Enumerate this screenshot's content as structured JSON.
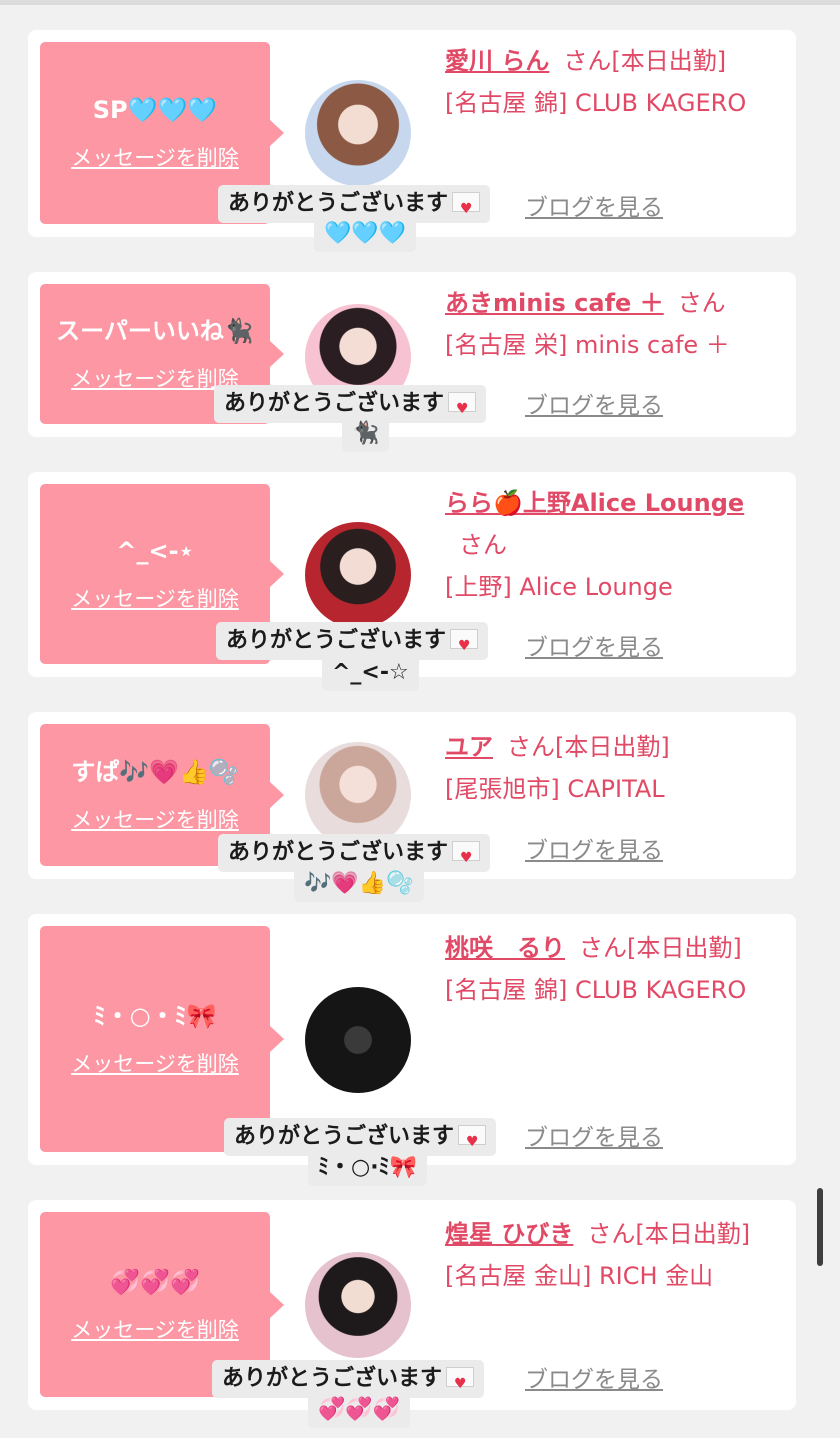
{
  "common": {
    "delete_label": "メッセージを削除",
    "blog_label": "ブログを見る",
    "thanks_text": "ありがとうございます",
    "envelope_icon": "love-letter-icon",
    "accent_color": "#e14a66",
    "bubble_color": "#fd97a4"
  },
  "cards": [
    {
      "stamp": "SP🩵🩵🩵",
      "name": "愛川 らん",
      "san": "さん[本日出勤]",
      "shop": "[名古屋 錦] CLUB KAGERO",
      "reply": "🩵🩵🩵"
    },
    {
      "stamp": "スーパーいいね🐈‍⬛",
      "name": "あきminis cafe ＋",
      "san": "さん",
      "shop": "[名古屋 栄] minis cafe ＋",
      "reply": "🐈‍⬛"
    },
    {
      "stamp": "^_<-⋆",
      "name": "らら🍎上野Alice Lounge",
      "san": "さん",
      "shop": "[上野] Alice Lounge",
      "reply": "^_<-☆"
    },
    {
      "stamp": "すぱ🎶💗👍🫧",
      "name": "ユア",
      "san": "さん[本日出勤]",
      "shop": "[尾張旭市] CAPITAL",
      "reply": "🎶💗👍🫧"
    },
    {
      "stamp": "ﾐ・○・ﾐ🎀",
      "name": "桃咲　るり",
      "san": "さん[本日出勤]",
      "shop": "[名古屋 錦] CLUB KAGERO",
      "reply": "ﾐ・○·ﾐ🎀"
    },
    {
      "stamp": "💞💞💞",
      "name": "煌星 ひびき",
      "san": "さん[本日出勤]",
      "shop": "[名古屋 金山] RICH 金山",
      "reply": "💞💞💞"
    }
  ]
}
